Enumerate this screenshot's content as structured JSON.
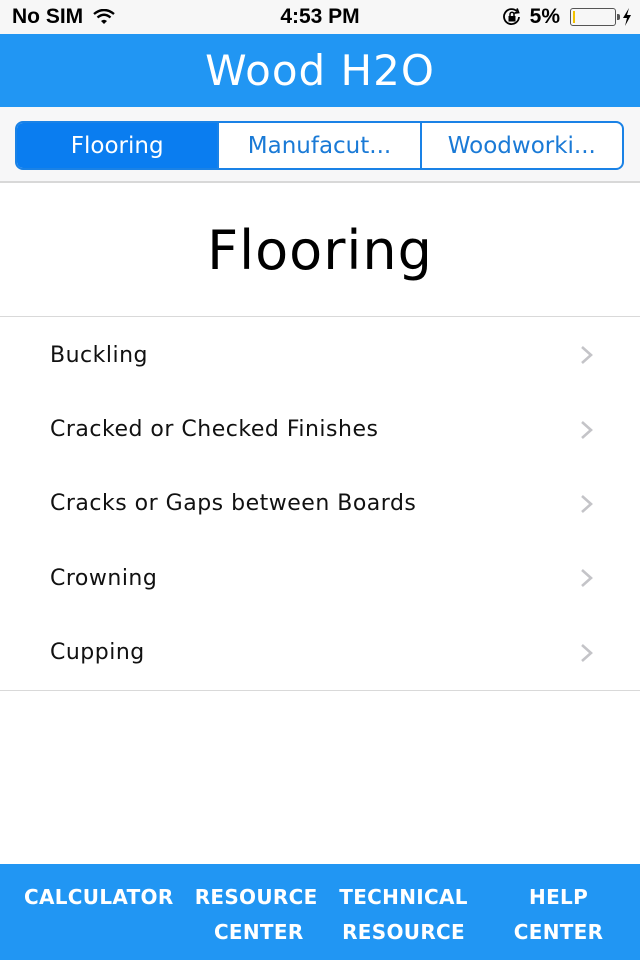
{
  "status_bar": {
    "carrier": "No SIM",
    "time": "4:53 PM",
    "battery_percent": "5%",
    "battery_level": 0.05,
    "icons": [
      "wifi-icon",
      "rotation-lock-icon",
      "battery-icon",
      "charging-bolt-icon"
    ]
  },
  "nav_bar": {
    "title": "Wood H2O",
    "color": "#2196f3"
  },
  "segmented_control": {
    "segments": [
      {
        "label": "Flooring",
        "active": true
      },
      {
        "label": "Manufacut...",
        "active": false
      },
      {
        "label": "Woodworki...",
        "active": false
      }
    ],
    "accent": "#0a7df0"
  },
  "content": {
    "heading": "Flooring",
    "items": [
      {
        "label": "Buckling"
      },
      {
        "label": "Cracked or Checked Finishes"
      },
      {
        "label": "Cracks or Gaps between Boards"
      },
      {
        "label": "Crowning"
      },
      {
        "label": "Cupping"
      }
    ]
  },
  "tab_bar": {
    "tabs": [
      {
        "line1": "CALCULATOR",
        "line2": ""
      },
      {
        "line1": "RESOURCE",
        "line2": "CENTER"
      },
      {
        "line1": "TECHNICAL",
        "line2": "RESOURCE"
      },
      {
        "line1": "HELP",
        "line2": "CENTER"
      }
    ]
  }
}
